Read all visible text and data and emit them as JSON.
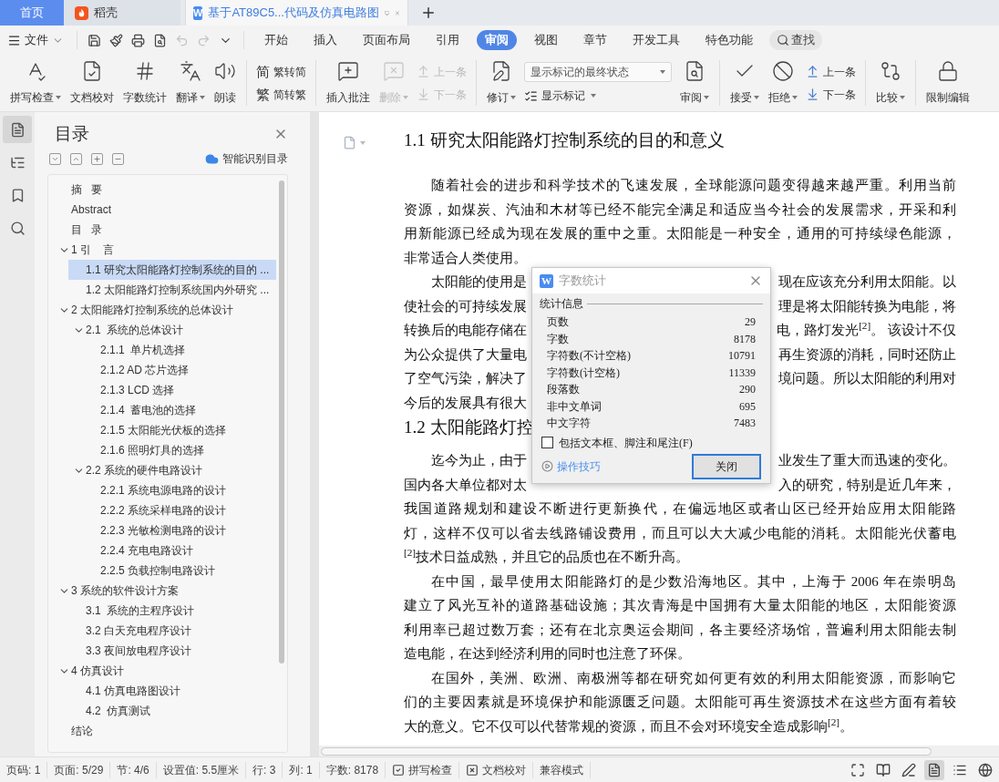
{
  "tabs": [
    {
      "kind": "home",
      "label": "首页",
      "selected": false
    },
    {
      "kind": "app",
      "label": "稻壳",
      "selected": false
    },
    {
      "kind": "document",
      "label": "基于AT89C5...代码及仿真电路图",
      "logo_letter": "W",
      "selected": true
    }
  ],
  "menu": {
    "file": "文件",
    "quick_access": [
      {
        "disabled": false
      },
      {
        "disabled": false
      },
      {
        "disabled": false
      },
      {
        "disabled": false
      },
      {
        "disabled": true
      },
      {
        "disabled": true
      },
      {
        "disabled": false
      }
    ],
    "tabs": [
      {
        "label": "开始",
        "selected": false
      },
      {
        "label": "插入",
        "selected": false
      },
      {
        "label": "页面布局",
        "selected": false
      },
      {
        "label": "引用",
        "selected": false
      },
      {
        "label": "审阅",
        "selected": true
      },
      {
        "label": "视图",
        "selected": false
      },
      {
        "label": "章节",
        "selected": false
      },
      {
        "label": "开发工具",
        "selected": false
      },
      {
        "label": "特色功能",
        "selected": false
      }
    ],
    "search": "查找"
  },
  "ribbon": [
    {
      "items": [
        {
          "kind": "large",
          "label": "拼写检查",
          "dropdown": true,
          "disabled": false
        },
        {
          "kind": "large",
          "label": "文档校对",
          "dropdown": false,
          "disabled": false
        },
        {
          "kind": "large",
          "label": "字数统计",
          "dropdown": false,
          "disabled": false
        },
        {
          "kind": "large",
          "label": "翻译",
          "dropdown": true,
          "disabled": false
        },
        {
          "kind": "large",
          "label": "朗读",
          "dropdown": false,
          "disabled": false
        }
      ]
    },
    {
      "items": [
        {
          "kind": "stack",
          "rows": [
            {
              "glyph": "简",
              "label": "繁转简",
              "disabled": false
            },
            {
              "glyph": "繁",
              "label": "简转繁",
              "disabled": false
            }
          ]
        }
      ]
    },
    {
      "items": [
        {
          "kind": "large",
          "label": "插入批注",
          "dropdown": false,
          "disabled": false
        },
        {
          "kind": "large",
          "label": "删除",
          "dropdown": true,
          "disabled": true
        },
        {
          "kind": "stack",
          "rows": [
            {
              "label": "上一条",
              "disabled": true
            },
            {
              "label": "下一条",
              "disabled": true
            }
          ]
        }
      ]
    },
    {
      "items": [
        {
          "kind": "large",
          "label": "修订",
          "dropdown": true,
          "disabled": false
        },
        {
          "kind": "markup",
          "select": "显示标记的最终状态",
          "label": "显示标记",
          "dropdown": true
        },
        {
          "kind": "large",
          "label": "审阅",
          "dropdown": true,
          "disabled": false
        }
      ]
    },
    {
      "items": [
        {
          "kind": "large",
          "label": "接受",
          "dropdown": true,
          "disabled": false
        },
        {
          "kind": "large",
          "label": "拒绝",
          "dropdown": true,
          "disabled": false
        },
        {
          "kind": "stack",
          "rows": [
            {
              "label": "上一条",
              "disabled": false
            },
            {
              "label": "下一条",
              "disabled": false
            }
          ]
        }
      ]
    },
    {
      "items": [
        {
          "kind": "large",
          "label": "比较",
          "dropdown": true,
          "disabled": false
        }
      ]
    },
    {
      "items": [
        {
          "kind": "large",
          "label": "限制编辑",
          "dropdown": false,
          "disabled": false
        }
      ]
    }
  ],
  "rail": [
    {
      "selected": true
    },
    {
      "selected": false
    },
    {
      "selected": false
    },
    {
      "selected": false
    }
  ],
  "sidebar": {
    "title": "目录",
    "smart_button": "智能识别目录",
    "toc": [
      {
        "label": "摘   要",
        "selected": false
      },
      {
        "label": "Abstract",
        "selected": false
      },
      {
        "label": "目   录",
        "selected": false
      },
      {
        "label": "1 引    言",
        "selected": false,
        "expanded": true,
        "children": [
          {
            "label": "1.1 研究太阳能路灯控制系统的目的 ...",
            "selected": true
          },
          {
            "label": "1.2 太阳能路灯控制系统国内外研究 ...",
            "selected": false
          }
        ]
      },
      {
        "label": "2 太阳能路灯控制系统的总体设计",
        "selected": false,
        "expanded": true,
        "children": [
          {
            "label": "2.1  系统的总体设计",
            "selected": false,
            "expanded": true,
            "children": [
              {
                "label": "2.1.1  单片机选择",
                "selected": false
              },
              {
                "label": "2.1.2 AD 芯片选择",
                "selected": false
              },
              {
                "label": "2.1.3 LCD 选择",
                "selected": false
              },
              {
                "label": "2.1.4  蓄电池的选择",
                "selected": false
              },
              {
                "label": "2.1.5 太阳能光伏板的选择",
                "selected": false
              },
              {
                "label": "2.1.6 照明灯具的选择",
                "selected": false
              }
            ]
          },
          {
            "label": "2.2 系统的硬件电路设计",
            "selected": false,
            "expanded": true,
            "children": [
              {
                "label": "2.2.1 系统电源电路的设计",
                "selected": false
              },
              {
                "label": "2.2.2 系统采样电路的设计",
                "selected": false
              },
              {
                "label": "2.2.3 光敏检测电路的设计",
                "selected": false
              },
              {
                "label": "2.2.4 充电电路设计",
                "selected": false
              },
              {
                "label": "2.2.5 负载控制电路设计",
                "selected": false
              }
            ]
          }
        ]
      },
      {
        "label": "3 系统的软件设计方案",
        "selected": false,
        "expanded": true,
        "children": [
          {
            "label": "3.1  系统的主程序设计",
            "selected": false
          },
          {
            "label": "3.2 白天充电程序设计",
            "selected": false
          },
          {
            "label": "3.3 夜间放电程序设计",
            "selected": false
          }
        ]
      },
      {
        "label": "4 仿真设计",
        "selected": false,
        "expanded": true,
        "children": [
          {
            "label": "4.1 仿真电路图设计",
            "selected": false
          },
          {
            "label": "4.2  仿真测试",
            "selected": false
          }
        ]
      },
      {
        "label": "结论",
        "selected": false
      }
    ]
  },
  "document": {
    "blocks": [
      {
        "kind": "heading",
        "text": "1.1 研究太阳能路灯控制系统的目的和意义"
      },
      {
        "kind": "paragraph",
        "lines": [
          {
            "text": "随着社会的进步和科学技术的飞速发展，全球能源问题变得越来越严重。利用当前"
          },
          {
            "text": "资源，如煤炭、汽油和木材等已经不能完全满足和适应当今社会的发展需求，开采和利"
          },
          {
            "text": "用新能源已经成为现在发展的重中之重。太阳能是一种安全，通用的可持续绿色能源，"
          },
          {
            "text": "非常适合人类使用。"
          }
        ]
      },
      {
        "kind": "paragraph",
        "lines": [
          {
            "left": "太阳能的使用是",
            "right": "现在应该充分利用太阳能。以"
          },
          {
            "left": "使社会的可持续发展",
            "right": "理是将太阳能转换为电能，将"
          },
          {
            "left": "转换后的电能存储在",
            "right": "电，路灯发光$^{[2]}$。 该设计不仅"
          },
          {
            "left": "为公众提供了大量电",
            "right": "再生资源的消耗，同时还防止"
          },
          {
            "left": "了空气污染，解决了",
            "right": "境问题。所以太阳能的利用对"
          },
          {
            "left": "今后的发展具有很大"
          }
        ]
      },
      {
        "kind": "heading",
        "text": "1.2 太阳能路灯控"
      },
      {
        "kind": "paragraph",
        "lines": [
          {
            "left": "迄今为止，由于",
            "right": "业发生了重大而迅速的变化。"
          },
          {
            "left": "国内各大单位都对太",
            "right": "入的研究，特别是近几年来，"
          },
          {
            "text": "我国道路规划和建设不断进行更新换代，在偏远地区或者山区已经开始应用太阳能路"
          },
          {
            "text": "灯，这样不仅可以省去线路铺设费用，而且可以大大减少电能的消耗。太阳能光伏蓄电"
          },
          {
            "text": "$^{[2]}$技术日益成熟，并且它的品质也在不断升高。"
          }
        ]
      },
      {
        "kind": "paragraph",
        "lines": [
          {
            "text": "在中国，最早使用太阳能路灯的是少数沿海地区。其中，上海于 2006 年在崇明岛"
          },
          {
            "text": "建立了风光互补的道路基础设施；其次青海是中国拥有大量太阳能的地区，太阳能资源"
          },
          {
            "text": "利用率已超过数万套；还有在北京奥运会期间，各主要经济场馆，普遍利用太阳能去制"
          },
          {
            "text": "造电能，在达到经济利用的同时也注意了环保。"
          }
        ]
      },
      {
        "kind": "paragraph",
        "lines": [
          {
            "text": "在国外，美洲、欧洲、南极洲等都在研究如何更有效的利用太阳能资源，而影响它"
          },
          {
            "text": "们的主要因素就是环境保护和能源匮乏问题。太阳能可再生资源技术在这些方面有着较"
          },
          {
            "text": "大的意义。它不仅可以代替常规的资源，而且不会对环境安全造成影响$^{[2]}$。"
          }
        ]
      }
    ]
  },
  "dialog": {
    "logo_letter": "W",
    "title": "字数统计",
    "section": "统计信息",
    "stats": [
      {
        "label": "页数",
        "value": "29"
      },
      {
        "label": "字数",
        "value": "8178"
      },
      {
        "label": "字符数(不计空格)",
        "value": "10791"
      },
      {
        "label": "字符数(计空格)",
        "value": "11339"
      },
      {
        "label": "段落数",
        "value": "290"
      },
      {
        "label": "非中文单词",
        "value": "695"
      },
      {
        "label": "中文字符",
        "value": "7483"
      }
    ],
    "checkbox": {
      "label": "包括文本框、脚注和尾注(F)",
      "checked": false
    },
    "tips_link": "操作技巧",
    "close_button": "关闭"
  },
  "status_bar": {
    "items": [
      {
        "kind": "text",
        "label": "页码: 1"
      },
      {
        "kind": "text",
        "label": "页面: 5/29"
      },
      {
        "kind": "text",
        "label": "节: 4/6"
      },
      {
        "kind": "text",
        "label": "设置值: 5.5厘米"
      },
      {
        "kind": "text",
        "label": "行: 3"
      },
      {
        "kind": "text",
        "label": "列: 1"
      },
      {
        "kind": "text",
        "label": "字数: 8178"
      },
      {
        "kind": "tool",
        "label": "拼写检查"
      },
      {
        "kind": "tool",
        "label": "文档校对"
      },
      {
        "kind": "text",
        "label": "兼容模式"
      }
    ],
    "views": [
      {
        "selected": false
      },
      {
        "selected": false
      },
      {
        "selected": false
      },
      {
        "selected": true
      },
      {
        "selected": false
      },
      {
        "selected": false
      }
    ]
  }
}
